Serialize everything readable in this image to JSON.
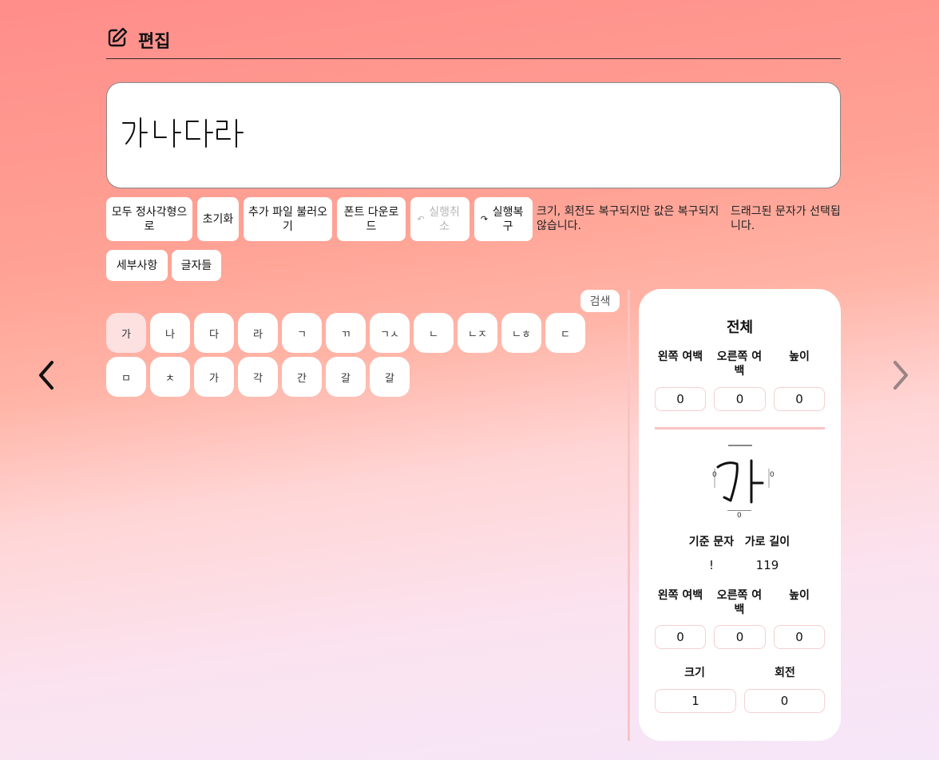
{
  "header": {
    "title": "편집"
  },
  "preview": {
    "text": "가나다라"
  },
  "toolbar": {
    "all_square": "모두 정사각형으로",
    "reset": "초기화",
    "load_extra": "추가 파일 불러오기",
    "download_font": "폰트 다운로드",
    "undo": "실행취소",
    "redo": "실행복구",
    "note1": "크기, 회전도 복구되지만 값은 복구되지 않습니다.",
    "note2": "드래그된 문자가 선택됩니다."
  },
  "tabs": {
    "details": "세부사항",
    "glyphs": "글자들"
  },
  "search": {
    "label": "검색"
  },
  "glyphs": [
    "가",
    "나",
    "다",
    "라",
    "ㄱ",
    "ㄲ",
    "ㄱㅅ",
    "ㄴ",
    "ㄴㅈ",
    "ㄴㅎ",
    "ㄷ",
    "ㅁ",
    "ㅊ",
    "가",
    "각",
    "간",
    "갈",
    "갈"
  ],
  "panel": {
    "overall_title": "전체",
    "left_margin": "왼쪽 여백",
    "right_margin": "오른쪽 여백",
    "height": "높이",
    "overall_values": {
      "left": "0",
      "right": "0",
      "height": "0"
    },
    "glyph_preview": "가",
    "base_char_label": "기준 문자",
    "width_label": "가로 길이",
    "base_char": "!",
    "width_value": "119",
    "glyph_values": {
      "left": "0",
      "right": "0",
      "height": "0"
    },
    "size_label": "크기",
    "rotate_label": "회전",
    "size_value": "1",
    "rotate_value": "0",
    "handle_value": "0"
  },
  "colors": {
    "accent": "#fbc3c3",
    "selected": "#fde0e0"
  }
}
